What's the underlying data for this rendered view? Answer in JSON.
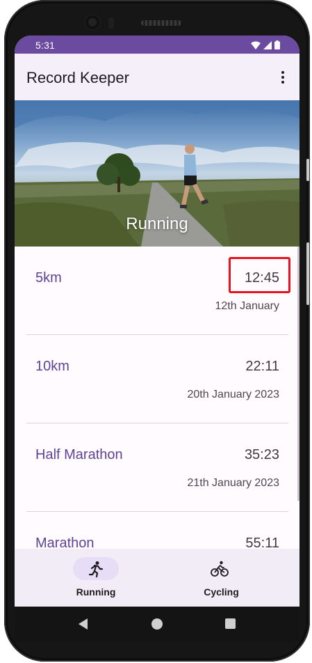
{
  "status_bar": {
    "time": "5:31"
  },
  "app_bar": {
    "title": "Record Keeper"
  },
  "hero": {
    "caption": "Running"
  },
  "records": [
    {
      "name": "5km",
      "time": "12:45",
      "date": "12th January"
    },
    {
      "name": "10km",
      "time": "22:11",
      "date": "20th January 2023"
    },
    {
      "name": "Half Marathon",
      "time": "35:23",
      "date": "21th January 2023"
    },
    {
      "name": "Marathon",
      "time": "55:11",
      "date": ""
    }
  ],
  "bottom_nav": {
    "items": [
      {
        "label": "Running",
        "icon": "running-icon",
        "selected": true
      },
      {
        "label": "Cycling",
        "icon": "bicycle-icon",
        "selected": false
      }
    ]
  },
  "colors": {
    "status_bar": "#6a4ba0",
    "app_bar": "#f4eff9",
    "record_name": "#5d4396",
    "nav_pill": "#e8ddf7",
    "highlight": "#e8121f"
  }
}
